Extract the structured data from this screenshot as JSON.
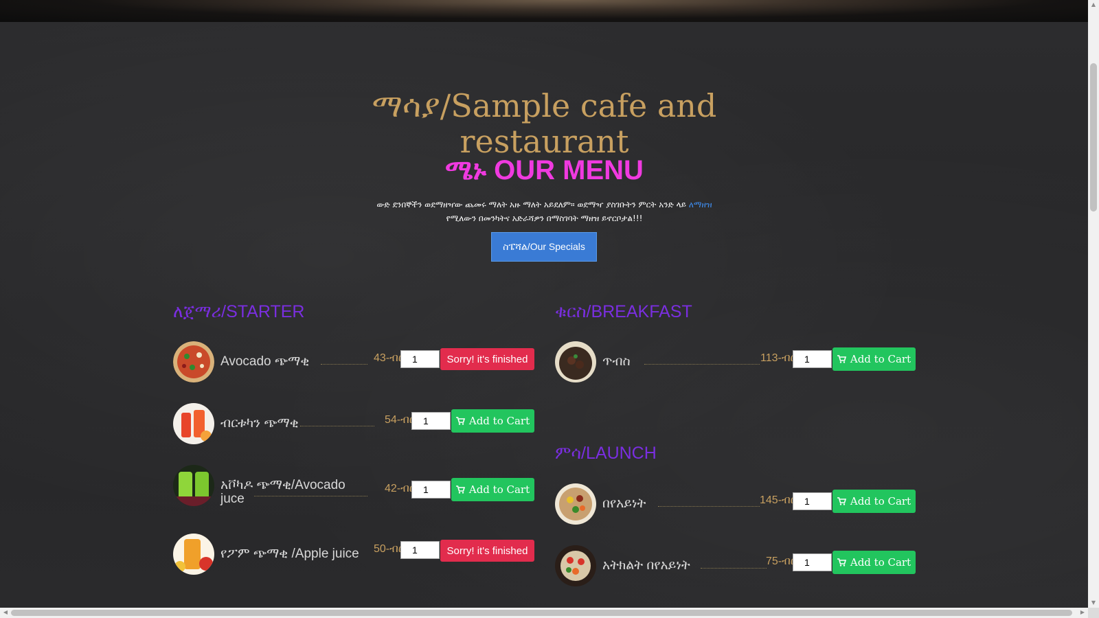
{
  "header": {
    "title": "ማሳያ/Sample cafe and restaurant",
    "menu_heading": "ሜኑ OUR MENU",
    "intro_text": "ውድ ደንበኞችን ወደማዘዣው ጨመሩ ማለት አዙ ማለት አይደለም። ወደማዣ ያስገቡትን ምርት አንድ ላይ",
    "order_link": "ለማዘዝ",
    "intro_text_2": "የሚለውን በመንካትና አድራሻዎን በማስገባት ማዘዝ ይኖርቦታል!!!",
    "specials_button": "ስፔሻል/Our Specials"
  },
  "sections": {
    "starter": {
      "title": "ለጀማሪ/STARTER",
      "items": [
        {
          "name": "Avocado ጭማቂ",
          "price": "43-ብር",
          "qty": "1",
          "status": "Sorry! it's finished"
        },
        {
          "name": "ብርቱካን ጭማቂ",
          "price": "54-ብር",
          "qty": "1",
          "status": "Add to Cart"
        },
        {
          "name": "አቮካዶ ጭማቂ/Avocado juce",
          "price": "42-ብር",
          "qty": "1",
          "status": "Add to Cart"
        },
        {
          "name": "የፖም ጭማቂ /Apple juice",
          "price": "50-ብር",
          "qty": "1",
          "status": "Sorry! it's finished"
        }
      ]
    },
    "breakfast": {
      "title": "ቁርስ/BREAKFAST",
      "items": [
        {
          "name": "ጥብስ",
          "price": "113-ብር",
          "qty": "1",
          "status": "Add to Cart"
        }
      ]
    },
    "launch": {
      "title": "ምሳ/LAUNCH",
      "items": [
        {
          "name": "በየአይነት",
          "price": "145-ብር",
          "qty": "1",
          "status": "Add to Cart"
        },
        {
          "name": "አትክልት በየአይነት",
          "price": "75-ብር",
          "qty": "1",
          "status": "Add to Cart"
        }
      ]
    }
  },
  "colors": {
    "title": "#c8a060",
    "menu_heading": "#f03ae0",
    "section_title": "#7a2ee0",
    "cart_button": "#22c55e",
    "finished_button": "#e22c4d",
    "specials_button": "#3a7bd5"
  }
}
